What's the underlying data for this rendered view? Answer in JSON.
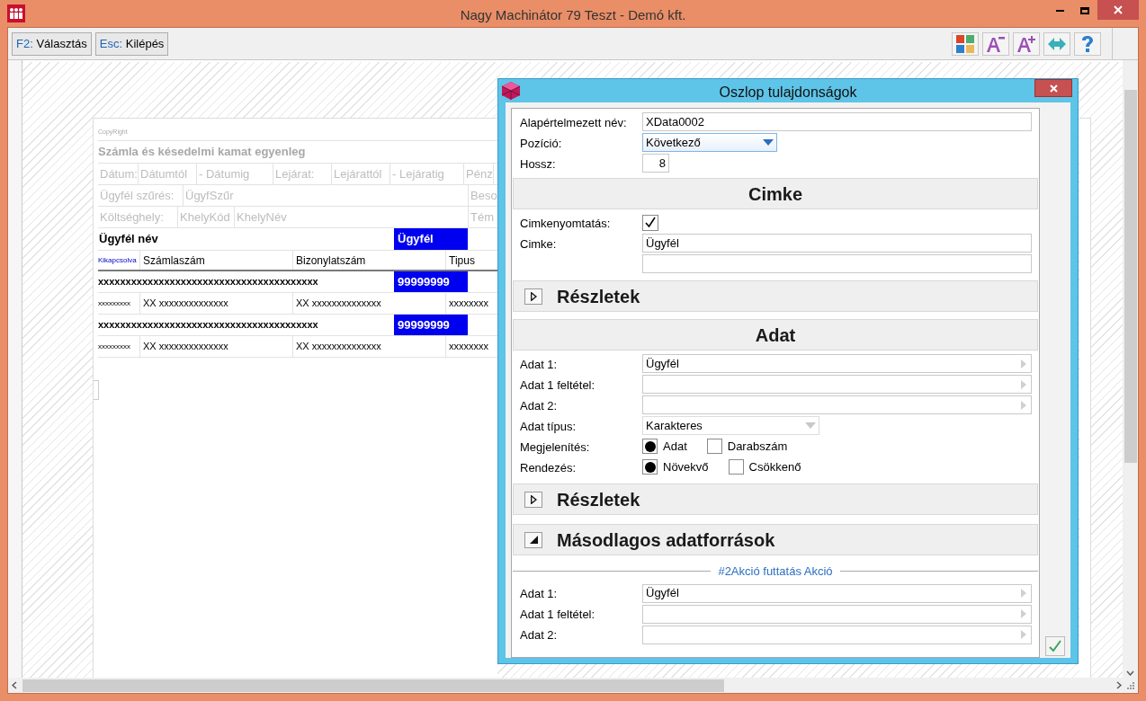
{
  "window": {
    "title": "Nagy Machinátor 79 Teszt - Demó kft."
  },
  "toolbar": {
    "buttons": [
      {
        "key": "F2:",
        "label": "Választás"
      },
      {
        "key": "Esc:",
        "label": "Kilépés"
      }
    ]
  },
  "report": {
    "copyright": "CopyRight",
    "title": "Számla és késedelmi kamat egyenleg",
    "filter_rows": [
      [
        "Dátum:",
        "Dátumtól",
        "- Dátumig",
        "Lejárat:",
        "Lejárattól",
        "- Lejáratig",
        "Pénz"
      ],
      [
        "Ügyfél szűrés:",
        "ÜgyfSzűr",
        "Beso"
      ],
      [
        "Költséghely:",
        "KhelyKód",
        "KhelyNév",
        "Tém"
      ]
    ],
    "group_header": {
      "label": "Ügyfél név",
      "column": "Ügyfél",
      "selected": true
    },
    "columns": [
      "Kikapcsolva",
      "Számlaszám",
      "Bizonylatszám",
      "Tipus"
    ],
    "rows": [
      {
        "kind": "group",
        "name": "xxxxxxxxxxxxxxxxxxxxxxxxxxxxxxxxxxxxxxxx",
        "code": "99999999",
        "selected": true
      },
      {
        "kind": "detail",
        "cells": [
          "xxxxxxxxx",
          "XX xxxxxxxxxxxxxx",
          "XX xxxxxxxxxxxxxx",
          "xxxxxxxx"
        ]
      },
      {
        "kind": "group",
        "name": "xxxxxxxxxxxxxxxxxxxxxxxxxxxxxxxxxxxxxxxx",
        "code": "99999999",
        "selected": true
      },
      {
        "kind": "detail",
        "cells": [
          "xxxxxxxxx",
          "XX xxxxxxxxxxxxxx",
          "XX xxxxxxxxxxxxxx",
          "xxxxxxxx"
        ]
      }
    ]
  },
  "dialog": {
    "title": "Oszlop tulajdonságok",
    "blocks": [
      {
        "kind": "plain",
        "rows": [
          {
            "kind": "text",
            "label": "Alapértelmezett név:",
            "value": "XData0002"
          },
          {
            "kind": "dropdown",
            "label": "Pozíció:",
            "value": "Következő"
          },
          {
            "kind": "number",
            "label": "Hossz:",
            "value": "8"
          }
        ]
      },
      {
        "kind": "heading",
        "title": "Cimke",
        "rows": [
          {
            "kind": "checkbox",
            "label": "Cimkenyomtatás:",
            "checked": true
          },
          {
            "kind": "text",
            "label": "Cimke:",
            "value": "Ügyfél"
          },
          {
            "kind": "text"
          }
        ]
      },
      {
        "kind": "collapsible",
        "title": "Részletek",
        "expanded": false
      },
      {
        "kind": "heading",
        "title": "Adat",
        "rows": [
          {
            "kind": "picker",
            "label": "Adat 1:",
            "value": "Ügyfél"
          },
          {
            "kind": "picker",
            "label": "Adat 1 feltétel:"
          },
          {
            "kind": "picker",
            "label": "Adat 2:"
          },
          {
            "kind": "combo",
            "label": "Adat típus:",
            "value": "Karakteres"
          },
          {
            "kind": "radio",
            "label": "Megjelenítés:",
            "options": [
              {
                "label": "Adat",
                "selected": true
              },
              {
                "label": "Darabszám",
                "selected": false
              }
            ]
          },
          {
            "kind": "radio",
            "label": "Rendezés:",
            "options": [
              {
                "label": "Növekvő",
                "selected": true
              },
              {
                "label": "Csökkenő",
                "selected": false
              }
            ]
          }
        ]
      },
      {
        "kind": "collapsible",
        "title": "Részletek",
        "expanded": false
      },
      {
        "kind": "collapsible",
        "title": "Másodlagos adatforrások",
        "expanded": true
      },
      {
        "kind": "separator",
        "title": "#2Akció futtatás Akció",
        "rows": [
          {
            "kind": "picker",
            "label": "Adat 1:",
            "value": "Ügyfél"
          },
          {
            "kind": "picker",
            "label": "Adat 1 feltétel:"
          },
          {
            "kind": "picker",
            "label": "Adat 2:"
          }
        ]
      }
    ]
  }
}
